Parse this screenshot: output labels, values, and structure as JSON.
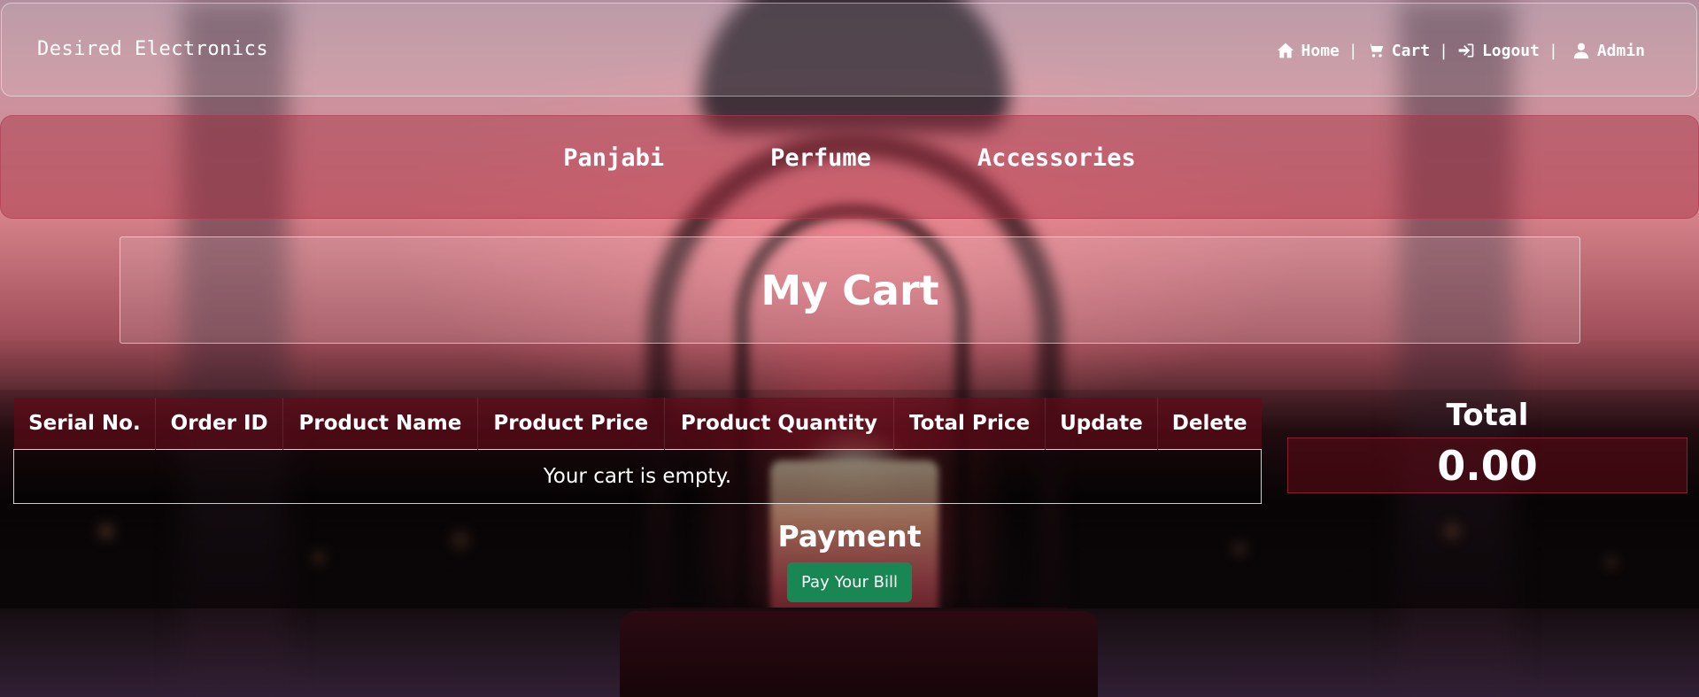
{
  "header": {
    "brand": "Desired Electronics",
    "nav": [
      {
        "label": "Home",
        "icon": "home-icon"
      },
      {
        "label": "Cart",
        "icon": "cart-icon"
      },
      {
        "label": "Logout",
        "icon": "logout-icon"
      },
      {
        "label": "Admin",
        "icon": "user-icon"
      }
    ],
    "separator": "|"
  },
  "categories": [
    "Panjabi",
    "Perfume",
    "Accessories"
  ],
  "page_title": "My Cart",
  "cart_table": {
    "columns": [
      "Serial No.",
      "Order ID",
      "Product Name",
      "Product Price",
      "Product Quantity",
      "Total Price",
      "Update",
      "Delete"
    ],
    "empty_message": "Your cart is empty."
  },
  "total": {
    "label": "Total",
    "value": "0.00"
  },
  "payment": {
    "title": "Payment",
    "button_label": "Pay Your Bill",
    "button_color": "#198754"
  }
}
